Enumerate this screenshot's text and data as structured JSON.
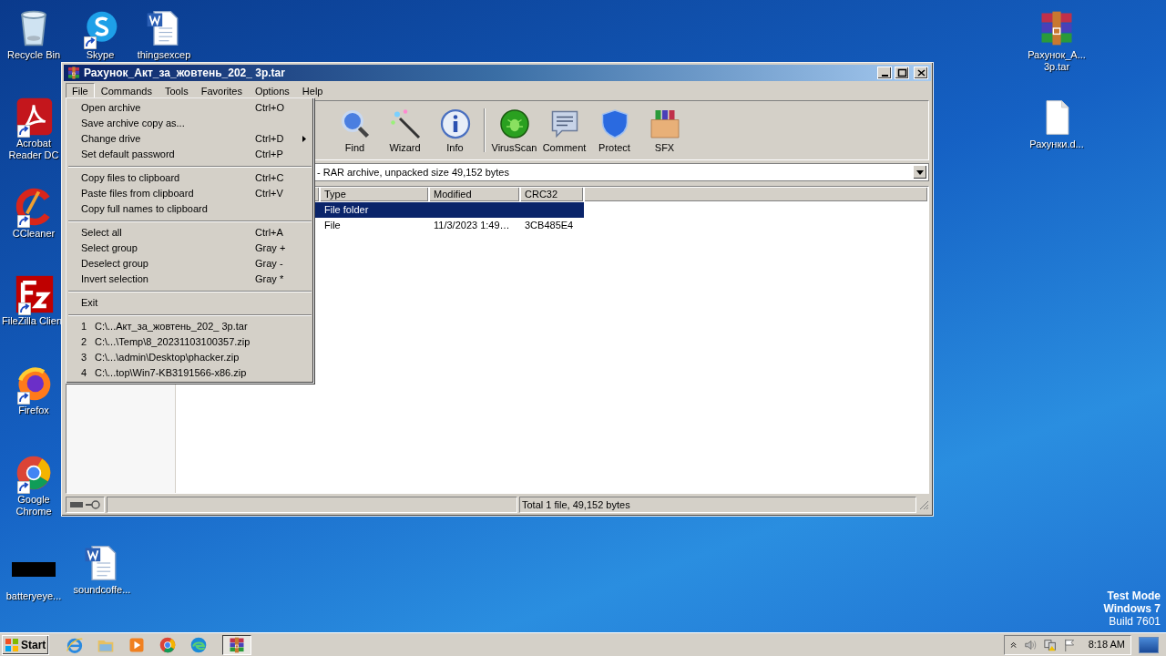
{
  "desktop": {
    "icons": [
      {
        "label": "Recycle Bin",
        "kind": "recycle",
        "shortcut": false
      },
      {
        "label": "Skype",
        "kind": "skype",
        "shortcut": true
      },
      {
        "label": "thingsexcep",
        "kind": "word",
        "shortcut": false
      },
      {
        "label": "Acrobat Reader DC",
        "kind": "acrobat",
        "shortcut": true
      },
      {
        "label": "CCleaner",
        "kind": "ccleaner",
        "shortcut": true
      },
      {
        "label": "FileZilla Clien",
        "kind": "filezilla",
        "shortcut": true
      },
      {
        "label": "Firefox",
        "kind": "firefox",
        "shortcut": true
      },
      {
        "label": "Google Chrome",
        "kind": "chrome",
        "shortcut": true
      },
      {
        "label": "batteryeye...",
        "kind": "black",
        "shortcut": false
      },
      {
        "label": "soundcoffe...",
        "kind": "word",
        "shortcut": false
      },
      {
        "label": "Рахунок_А... 3p.tar",
        "kind": "rar",
        "shortcut": false
      },
      {
        "label": "Рахунки.d...",
        "kind": "blank",
        "shortcut": false
      }
    ],
    "watermark": [
      "Test Mode",
      "Windows 7",
      "Build 7601"
    ]
  },
  "window": {
    "title": "Рахунок_Акт_за_жовтень_202_ 3p.tar",
    "menu": [
      {
        "label": "File",
        "selected": true
      },
      {
        "label": "Commands",
        "selected": false
      },
      {
        "label": "Tools",
        "selected": false
      },
      {
        "label": "Favorites",
        "selected": false
      },
      {
        "label": "Options",
        "selected": false
      },
      {
        "label": "Help",
        "selected": false
      }
    ],
    "file_menu": {
      "groups": [
        [
          {
            "label": "Open archive",
            "shortcut": "Ctrl+O",
            "submenu": false
          },
          {
            "label": "Save archive copy as...",
            "submenu": false
          },
          {
            "label": "Change drive",
            "shortcut": "Ctrl+D",
            "submenu": true
          },
          {
            "label": "Set default password",
            "shortcut": "Ctrl+P",
            "submenu": false
          }
        ],
        [
          {
            "label": "Copy files to clipboard",
            "shortcut": "Ctrl+C",
            "submenu": false
          },
          {
            "label": "Paste files from clipboard",
            "shortcut": "Ctrl+V",
            "submenu": false
          },
          {
            "label": "Copy full names to clipboard",
            "submenu": false
          }
        ],
        [
          {
            "label": "Select all",
            "shortcut": "Ctrl+A",
            "submenu": false
          },
          {
            "label": "Select group",
            "shortcut": "Gray +",
            "submenu": false
          },
          {
            "label": "Deselect group",
            "shortcut": "Gray -",
            "submenu": false
          },
          {
            "label": "Invert selection",
            "shortcut": "Gray *",
            "submenu": false
          }
        ],
        [
          {
            "label": "Exit",
            "submenu": false
          }
        ]
      ],
      "recent": [
        {
          "number": "1",
          "path": "C:\\...Акт_за_жовтень_202_ 3p.tar"
        },
        {
          "number": "2",
          "path": "C:\\...\\Temp\\8_20231103100357.zip"
        },
        {
          "number": "3",
          "path": "C:\\...\\admin\\Desktop\\phacker.zip"
        },
        {
          "number": "4",
          "path": "C:\\...top\\Win7-KB3191566-x86.zip"
        }
      ]
    },
    "toolbar": [
      {
        "label": "Find",
        "kind": "find"
      },
      {
        "label": "Wizard",
        "kind": "wizard"
      },
      {
        "label": "Info",
        "kind": "info"
      },
      {
        "kind": "separator"
      },
      {
        "label": "VirusScan",
        "kind": "virusscan"
      },
      {
        "label": "Comment",
        "kind": "comment"
      },
      {
        "label": "Protect",
        "kind": "protect"
      },
      {
        "label": "SFX",
        "kind": "sfx"
      }
    ],
    "address": "- RAR archive, unpacked size 49,152 bytes",
    "columns": [
      "Type",
      "Modified",
      "CRC32"
    ],
    "rows": [
      {
        "type": "File folder",
        "selected": true
      },
      {
        "type": "File",
        "modified": "11/3/2023 1:49…",
        "crc32": "3CB485E4",
        "selected": false
      }
    ],
    "status": "Total 1 file, 49,152 bytes"
  },
  "taskbar": {
    "start": "Start",
    "apps": [
      {
        "kind": "ie",
        "active": false
      },
      {
        "kind": "explorer",
        "active": false
      },
      {
        "kind": "media",
        "active": false
      },
      {
        "kind": "chrome",
        "active": false
      },
      {
        "kind": "edge",
        "active": false
      },
      {
        "kind": "winrar",
        "active": true
      }
    ],
    "clock": "8:18 AM"
  }
}
